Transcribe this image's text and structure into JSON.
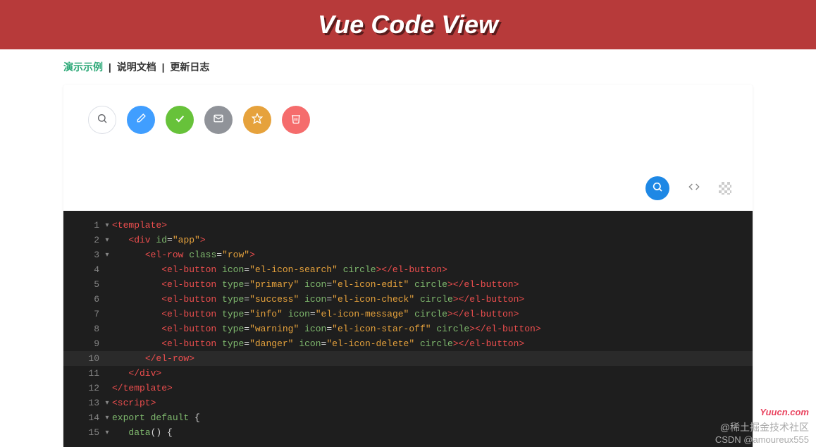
{
  "header": {
    "title": "Vue Code View"
  },
  "nav": {
    "active": "演示示例",
    "sep": " | ",
    "link1": "说明文档",
    "link2": "更新日志"
  },
  "buttons": [
    {
      "name": "search",
      "type": "default"
    },
    {
      "name": "edit",
      "type": "primary"
    },
    {
      "name": "check",
      "type": "success"
    },
    {
      "name": "message",
      "type": "info"
    },
    {
      "name": "star",
      "type": "warning"
    },
    {
      "name": "delete",
      "type": "danger"
    }
  ],
  "toolbar": {
    "zoom": "search-icon",
    "code": "code-icon",
    "transparency": "checker-icon"
  },
  "code": {
    "highlighted_line": 10,
    "lines": [
      {
        "n": 1,
        "fold": true,
        "indent": 0,
        "t": [
          [
            "tag",
            "<template>"
          ]
        ]
      },
      {
        "n": 2,
        "fold": true,
        "indent": 1,
        "t": [
          [
            "tag",
            "<div "
          ],
          [
            "attr",
            "id"
          ],
          [
            "punc",
            "="
          ],
          [
            "str",
            "\"app\""
          ],
          [
            "tag",
            ">"
          ]
        ]
      },
      {
        "n": 3,
        "fold": true,
        "indent": 2,
        "t": [
          [
            "tag",
            "<el-row "
          ],
          [
            "attr",
            "class"
          ],
          [
            "punc",
            "="
          ],
          [
            "str",
            "\"row\""
          ],
          [
            "tag",
            ">"
          ]
        ]
      },
      {
        "n": 4,
        "fold": false,
        "indent": 3,
        "t": [
          [
            "tag",
            "<el-button "
          ],
          [
            "attr",
            "icon"
          ],
          [
            "punc",
            "="
          ],
          [
            "str",
            "\"el-icon-search\""
          ],
          [
            "punc",
            " "
          ],
          [
            "attr",
            "circle"
          ],
          [
            "tag",
            "></el-button>"
          ]
        ]
      },
      {
        "n": 5,
        "fold": false,
        "indent": 3,
        "t": [
          [
            "tag",
            "<el-button "
          ],
          [
            "attr",
            "type"
          ],
          [
            "punc",
            "="
          ],
          [
            "str",
            "\"primary\""
          ],
          [
            "punc",
            " "
          ],
          [
            "attr",
            "icon"
          ],
          [
            "punc",
            "="
          ],
          [
            "str",
            "\"el-icon-edit\""
          ],
          [
            "punc",
            " "
          ],
          [
            "attr",
            "circle"
          ],
          [
            "tag",
            "></el-button>"
          ]
        ]
      },
      {
        "n": 6,
        "fold": false,
        "indent": 3,
        "t": [
          [
            "tag",
            "<el-button "
          ],
          [
            "attr",
            "type"
          ],
          [
            "punc",
            "="
          ],
          [
            "str",
            "\"success\""
          ],
          [
            "punc",
            " "
          ],
          [
            "attr",
            "icon"
          ],
          [
            "punc",
            "="
          ],
          [
            "str",
            "\"el-icon-check\""
          ],
          [
            "punc",
            " "
          ],
          [
            "attr",
            "circle"
          ],
          [
            "tag",
            "></el-button>"
          ]
        ]
      },
      {
        "n": 7,
        "fold": false,
        "indent": 3,
        "t": [
          [
            "tag",
            "<el-button "
          ],
          [
            "attr",
            "type"
          ],
          [
            "punc",
            "="
          ],
          [
            "str",
            "\"info\""
          ],
          [
            "punc",
            " "
          ],
          [
            "attr",
            "icon"
          ],
          [
            "punc",
            "="
          ],
          [
            "str",
            "\"el-icon-message\""
          ],
          [
            "punc",
            " "
          ],
          [
            "attr",
            "circle"
          ],
          [
            "tag",
            "></el-button>"
          ]
        ]
      },
      {
        "n": 8,
        "fold": false,
        "indent": 3,
        "t": [
          [
            "tag",
            "<el-button "
          ],
          [
            "attr",
            "type"
          ],
          [
            "punc",
            "="
          ],
          [
            "str",
            "\"warning\""
          ],
          [
            "punc",
            " "
          ],
          [
            "attr",
            "icon"
          ],
          [
            "punc",
            "="
          ],
          [
            "str",
            "\"el-icon-star-off\""
          ],
          [
            "punc",
            " "
          ],
          [
            "attr",
            "circle"
          ],
          [
            "tag",
            "></el-button>"
          ]
        ]
      },
      {
        "n": 9,
        "fold": false,
        "indent": 3,
        "t": [
          [
            "tag",
            "<el-button "
          ],
          [
            "attr",
            "type"
          ],
          [
            "punc",
            "="
          ],
          [
            "str",
            "\"danger\""
          ],
          [
            "punc",
            " "
          ],
          [
            "attr",
            "icon"
          ],
          [
            "punc",
            "="
          ],
          [
            "str",
            "\"el-icon-delete\""
          ],
          [
            "punc",
            " "
          ],
          [
            "attr",
            "circle"
          ],
          [
            "tag",
            "></el-button>"
          ]
        ]
      },
      {
        "n": 10,
        "fold": false,
        "indent": 2,
        "t": [
          [
            "tag",
            "</el-row>"
          ]
        ]
      },
      {
        "n": 11,
        "fold": false,
        "indent": 1,
        "t": [
          [
            "tag",
            "</div>"
          ]
        ]
      },
      {
        "n": 12,
        "fold": false,
        "indent": 0,
        "t": [
          [
            "tag",
            "</template>"
          ]
        ]
      },
      {
        "n": 13,
        "fold": true,
        "indent": 0,
        "t": [
          [
            "tag",
            "<script>"
          ]
        ]
      },
      {
        "n": 14,
        "fold": true,
        "indent": 0,
        "t": [
          [
            "kw",
            "export default"
          ],
          [
            "punc",
            " {"
          ]
        ]
      },
      {
        "n": 15,
        "fold": true,
        "indent": 1,
        "t": [
          [
            "kw",
            "data"
          ],
          [
            "punc",
            "() {"
          ]
        ]
      }
    ]
  },
  "watermarks": {
    "w1": "Yuucn.com",
    "w2": "@稀土掘金技术社区",
    "w3": "CSDN @amoureux555"
  }
}
